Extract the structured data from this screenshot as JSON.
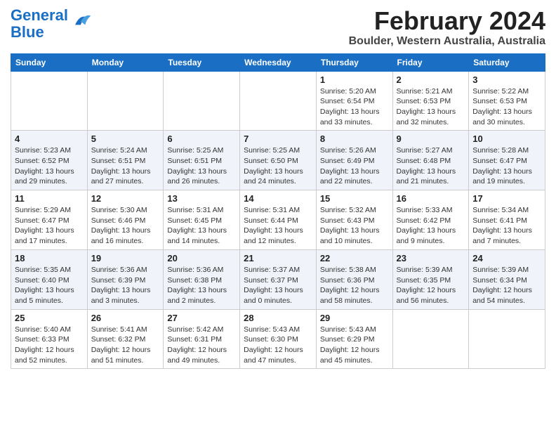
{
  "logo": {
    "line1": "General",
    "line2": "Blue"
  },
  "title": "February 2024",
  "subtitle": "Boulder, Western Australia, Australia",
  "weekdays": [
    "Sunday",
    "Monday",
    "Tuesday",
    "Wednesday",
    "Thursday",
    "Friday",
    "Saturday"
  ],
  "weeks": [
    [
      {
        "day": "",
        "info": ""
      },
      {
        "day": "",
        "info": ""
      },
      {
        "day": "",
        "info": ""
      },
      {
        "day": "",
        "info": ""
      },
      {
        "day": "1",
        "info": "Sunrise: 5:20 AM\nSunset: 6:54 PM\nDaylight: 13 hours and 33 minutes."
      },
      {
        "day": "2",
        "info": "Sunrise: 5:21 AM\nSunset: 6:53 PM\nDaylight: 13 hours and 32 minutes."
      },
      {
        "day": "3",
        "info": "Sunrise: 5:22 AM\nSunset: 6:53 PM\nDaylight: 13 hours and 30 minutes."
      }
    ],
    [
      {
        "day": "4",
        "info": "Sunrise: 5:23 AM\nSunset: 6:52 PM\nDaylight: 13 hours and 29 minutes."
      },
      {
        "day": "5",
        "info": "Sunrise: 5:24 AM\nSunset: 6:51 PM\nDaylight: 13 hours and 27 minutes."
      },
      {
        "day": "6",
        "info": "Sunrise: 5:25 AM\nSunset: 6:51 PM\nDaylight: 13 hours and 26 minutes."
      },
      {
        "day": "7",
        "info": "Sunrise: 5:25 AM\nSunset: 6:50 PM\nDaylight: 13 hours and 24 minutes."
      },
      {
        "day": "8",
        "info": "Sunrise: 5:26 AM\nSunset: 6:49 PM\nDaylight: 13 hours and 22 minutes."
      },
      {
        "day": "9",
        "info": "Sunrise: 5:27 AM\nSunset: 6:48 PM\nDaylight: 13 hours and 21 minutes."
      },
      {
        "day": "10",
        "info": "Sunrise: 5:28 AM\nSunset: 6:47 PM\nDaylight: 13 hours and 19 minutes."
      }
    ],
    [
      {
        "day": "11",
        "info": "Sunrise: 5:29 AM\nSunset: 6:47 PM\nDaylight: 13 hours and 17 minutes."
      },
      {
        "day": "12",
        "info": "Sunrise: 5:30 AM\nSunset: 6:46 PM\nDaylight: 13 hours and 16 minutes."
      },
      {
        "day": "13",
        "info": "Sunrise: 5:31 AM\nSunset: 6:45 PM\nDaylight: 13 hours and 14 minutes."
      },
      {
        "day": "14",
        "info": "Sunrise: 5:31 AM\nSunset: 6:44 PM\nDaylight: 13 hours and 12 minutes."
      },
      {
        "day": "15",
        "info": "Sunrise: 5:32 AM\nSunset: 6:43 PM\nDaylight: 13 hours and 10 minutes."
      },
      {
        "day": "16",
        "info": "Sunrise: 5:33 AM\nSunset: 6:42 PM\nDaylight: 13 hours and 9 minutes."
      },
      {
        "day": "17",
        "info": "Sunrise: 5:34 AM\nSunset: 6:41 PM\nDaylight: 13 hours and 7 minutes."
      }
    ],
    [
      {
        "day": "18",
        "info": "Sunrise: 5:35 AM\nSunset: 6:40 PM\nDaylight: 13 hours and 5 minutes."
      },
      {
        "day": "19",
        "info": "Sunrise: 5:36 AM\nSunset: 6:39 PM\nDaylight: 13 hours and 3 minutes."
      },
      {
        "day": "20",
        "info": "Sunrise: 5:36 AM\nSunset: 6:38 PM\nDaylight: 13 hours and 2 minutes."
      },
      {
        "day": "21",
        "info": "Sunrise: 5:37 AM\nSunset: 6:37 PM\nDaylight: 13 hours and 0 minutes."
      },
      {
        "day": "22",
        "info": "Sunrise: 5:38 AM\nSunset: 6:36 PM\nDaylight: 12 hours and 58 minutes."
      },
      {
        "day": "23",
        "info": "Sunrise: 5:39 AM\nSunset: 6:35 PM\nDaylight: 12 hours and 56 minutes."
      },
      {
        "day": "24",
        "info": "Sunrise: 5:39 AM\nSunset: 6:34 PM\nDaylight: 12 hours and 54 minutes."
      }
    ],
    [
      {
        "day": "25",
        "info": "Sunrise: 5:40 AM\nSunset: 6:33 PM\nDaylight: 12 hours and 52 minutes."
      },
      {
        "day": "26",
        "info": "Sunrise: 5:41 AM\nSunset: 6:32 PM\nDaylight: 12 hours and 51 minutes."
      },
      {
        "day": "27",
        "info": "Sunrise: 5:42 AM\nSunset: 6:31 PM\nDaylight: 12 hours and 49 minutes."
      },
      {
        "day": "28",
        "info": "Sunrise: 5:43 AM\nSunset: 6:30 PM\nDaylight: 12 hours and 47 minutes."
      },
      {
        "day": "29",
        "info": "Sunrise: 5:43 AM\nSunset: 6:29 PM\nDaylight: 12 hours and 45 minutes."
      },
      {
        "day": "",
        "info": ""
      },
      {
        "day": "",
        "info": ""
      }
    ]
  ]
}
